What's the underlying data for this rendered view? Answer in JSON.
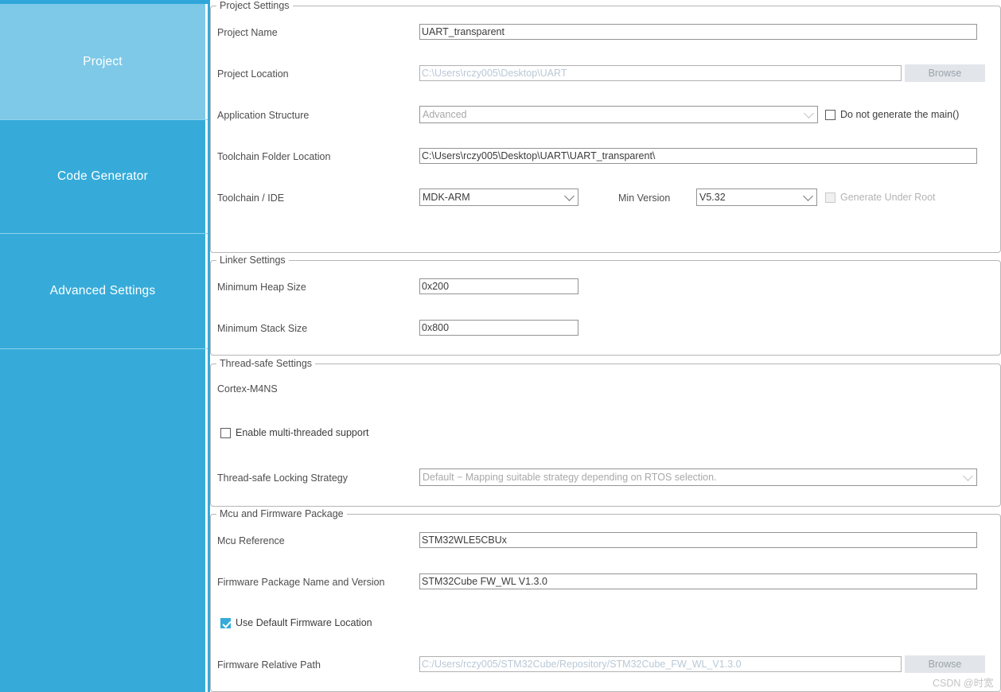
{
  "app": {
    "accent_color": "#36abd9",
    "accent_light": "#7fc9e8"
  },
  "sidebar": {
    "items": [
      {
        "label": "Project",
        "active": true
      },
      {
        "label": "Code Generator",
        "active": false
      },
      {
        "label": "Advanced Settings",
        "active": false
      },
      {
        "label": "",
        "active": false
      }
    ]
  },
  "project_settings": {
    "legend": "Project Settings",
    "project_name": {
      "label": "Project Name",
      "value": "UART_transparent"
    },
    "project_location": {
      "label": "Project Location",
      "value": "C:\\Users\\rczy005\\Desktop\\UART",
      "browse": "Browse"
    },
    "application_structure": {
      "label": "Application Structure",
      "value": "Advanced"
    },
    "do_not_generate_main": {
      "label": "Do not generate the main()",
      "checked": false
    },
    "toolchain_folder_location": {
      "label": "Toolchain Folder Location",
      "value": "C:\\Users\\rczy005\\Desktop\\UART\\UART_transparent\\"
    },
    "toolchain_ide": {
      "label": "Toolchain / IDE",
      "value": "MDK-ARM"
    },
    "min_version": {
      "label": "Min Version",
      "value": "V5.32"
    },
    "generate_under_root": {
      "label": "Generate Under Root",
      "checked": false,
      "disabled": true
    }
  },
  "linker_settings": {
    "legend": "Linker Settings",
    "minimum_heap_size": {
      "label": "Minimum Heap Size",
      "value": "0x200"
    },
    "minimum_stack_size": {
      "label": "Minimum Stack Size",
      "value": "0x800"
    }
  },
  "thread_safe_settings": {
    "legend": "Thread-safe Settings",
    "core": "Cortex-M4NS",
    "enable_multithreaded": {
      "label": "Enable multi-threaded support",
      "checked": false
    },
    "locking_strategy": {
      "label": "Thread-safe Locking Strategy",
      "value": "Default  −  Mapping suitable strategy depending on RTOS selection."
    }
  },
  "mcu_firmware": {
    "legend": "Mcu and Firmware Package",
    "mcu_reference": {
      "label": "Mcu Reference",
      "value": "STM32WLE5CBUx"
    },
    "firmware_package": {
      "label": "Firmware Package Name and Version",
      "value": "STM32Cube FW_WL V1.3.0"
    },
    "use_default_firmware_location": {
      "label": "Use Default Firmware Location",
      "checked": true
    },
    "firmware_relative_path": {
      "label": "Firmware Relative Path",
      "value": "C:/Users/rczy005/STM32Cube/Repository/STM32Cube_FW_WL_V1.3.0",
      "browse": "Browse"
    }
  },
  "watermark": {
    "text": "CSDN @时宽"
  }
}
